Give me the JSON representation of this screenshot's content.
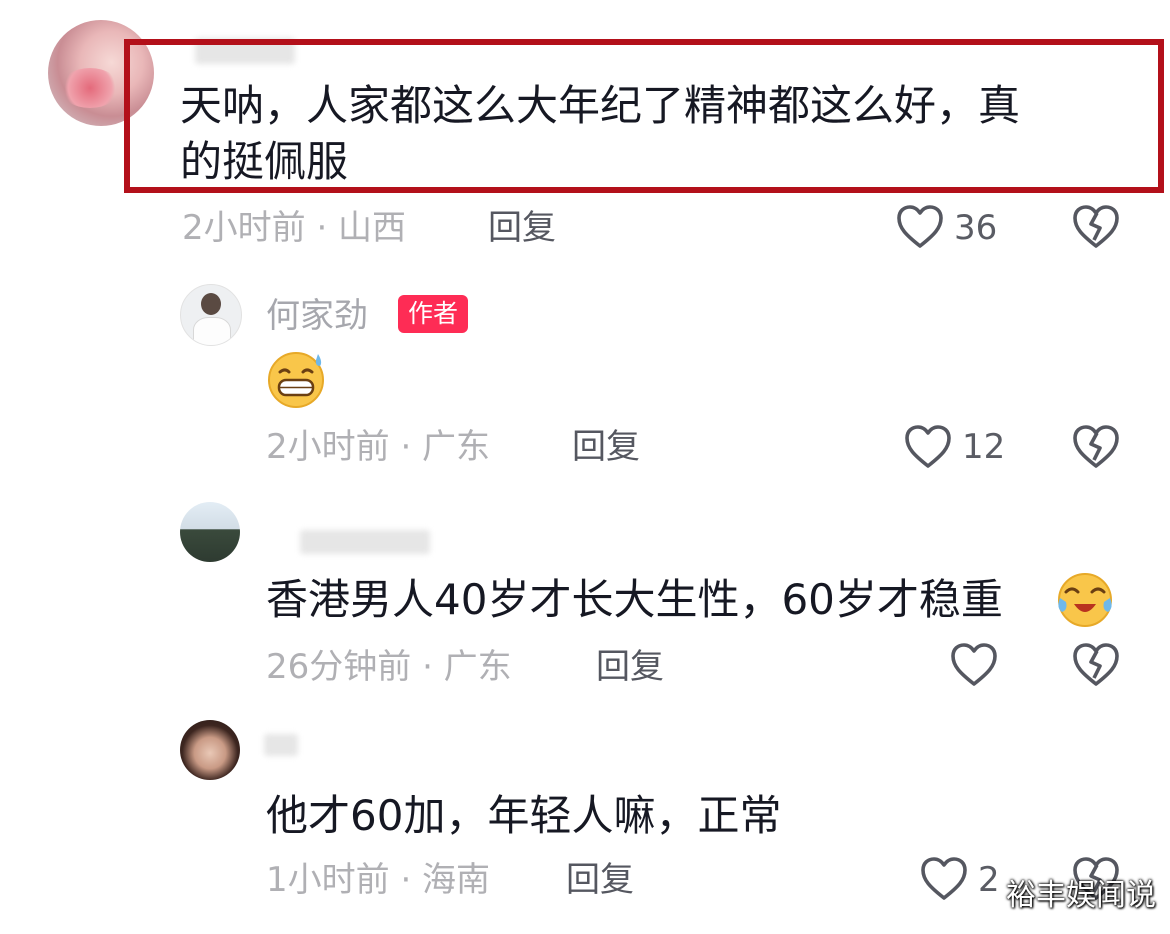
{
  "colors": {
    "accent_badge": "#fe2c55",
    "highlight_box": "#b3101a",
    "meta_gray": "#b0b0b4"
  },
  "comments": [
    {
      "body_line1": "天呐，人家都这么大年纪了精神都这么好，真",
      "body_line2": "的挺佩服",
      "time_location": "2小时前 · 山西",
      "reply_label": "回复",
      "likes": "36",
      "icons": [
        "heart-outline-icon",
        "broken-heart-icon"
      ],
      "replies": [
        {
          "author": "何家劲",
          "author_badge": "作者",
          "emoji": "grin-sweat-emoji",
          "time_location": "2小时前 · 广东",
          "reply_label": "回复",
          "likes": "12"
        },
        {
          "body": "香港男人40岁才长大生性，60岁才稳重",
          "emoji": "teary-laugh-emoji",
          "time_location": "26分钟前 · 广东",
          "reply_label": "回复",
          "likes": ""
        },
        {
          "body": "他才60加，年轻人嘛，正常",
          "time_location": "1小时前 · 海南",
          "reply_label": "回复",
          "likes": "2"
        }
      ]
    }
  ],
  "watermark": "裕丰娱闻说"
}
